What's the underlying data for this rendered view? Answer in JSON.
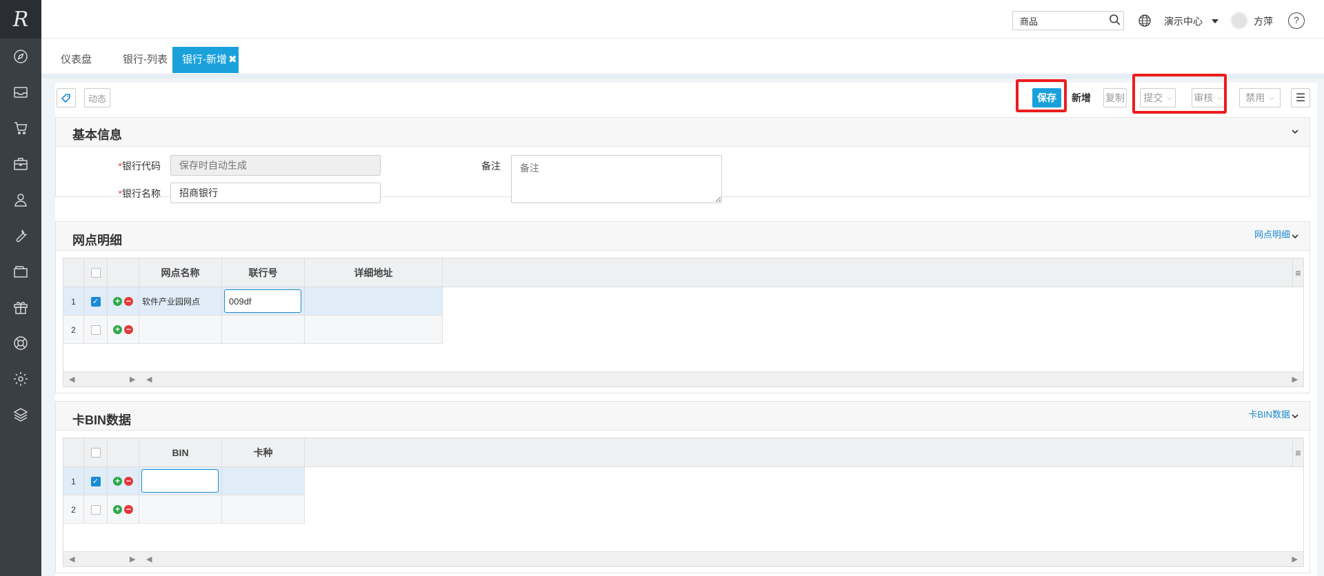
{
  "sidebar": {
    "logo": "R",
    "icons": [
      "compass-icon",
      "inbox-icon",
      "cart-icon",
      "briefcase-icon",
      "user-icon",
      "wrench-icon",
      "folder-icon",
      "gift-icon",
      "lifebuoy-icon",
      "gear-icon",
      "layers-icon"
    ]
  },
  "header": {
    "search_value": "商品",
    "center_label": "演示中心",
    "user_name": "方萍",
    "help": "?"
  },
  "tabs": [
    {
      "label": "仪表盘"
    },
    {
      "label": "银行-列表"
    },
    {
      "label": "银行-新增",
      "close": "✖"
    }
  ],
  "toolbar": {
    "activity_label": "动态",
    "save_label": "保存",
    "new_label": "新增",
    "copy_label": "复制",
    "submit_label": "提交",
    "review_label": "审核",
    "disable_label": "禁用"
  },
  "basic_info": {
    "title": "基本信息",
    "bank_code_label": "银行代码",
    "bank_code_placeholder": "保存时自动生成",
    "bank_name_label": "银行名称",
    "bank_name_value": "招商银行",
    "remark_label": "备注",
    "remark_placeholder": "备注"
  },
  "branch": {
    "title": "网点明细",
    "link": "网点明细",
    "columns": [
      "网点名称",
      "联行号",
      "详细地址"
    ],
    "rows": [
      {
        "no": "1",
        "checked": true,
        "name": "软件产业园网点",
        "code": "009df",
        "address": ""
      },
      {
        "no": "2",
        "checked": false,
        "name": "",
        "code": "",
        "address": ""
      }
    ]
  },
  "cardbin": {
    "title": "卡BIN数据",
    "link": "卡BIN数据",
    "columns": [
      "BIN",
      "卡种"
    ],
    "rows": [
      {
        "no": "1",
        "checked": true,
        "bin": "",
        "type": ""
      },
      {
        "no": "2",
        "checked": false,
        "bin": "",
        "type": ""
      }
    ]
  },
  "colors": {
    "sidebar": "#3a3f44",
    "accent": "#1aa1dc",
    "highlight_box": "#ee1c1c"
  }
}
